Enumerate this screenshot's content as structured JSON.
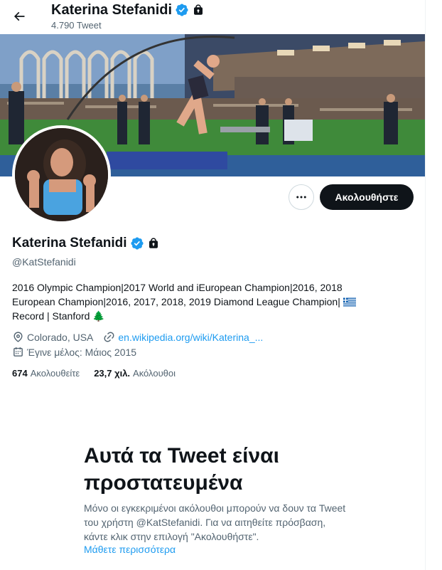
{
  "header": {
    "name": "Katerina Stefanidi",
    "tweet_count": "4.790 Tweet"
  },
  "actions": {
    "follow_label": "Ακολουθήστε",
    "more_label": "···"
  },
  "profile": {
    "name": "Katerina Stefanidi",
    "handle": "@KatStefanidi",
    "bio_line1": "2016 Olympic Champion|2017 World and iEuropean Champion|2016, 2018",
    "bio_line2": "European Champion|2016, 2017, 2018, 2019 Diamond League Champion|",
    "bio_line3a": "Record | Stanford",
    "bio_tree": "🌲",
    "location": "Colorado, USA",
    "website": "en.wikipedia.org/wiki/Katerina_...",
    "joined": "Έγινε μέλος: Μάιος 2015",
    "following_count": "674",
    "following_label": "Ακολουθείτε",
    "followers_count": "23,7 χιλ.",
    "followers_label": "Ακόλουθοι"
  },
  "protected": {
    "title": "Αυτά τα Tweet είναι προστατευμένα",
    "text": "Μόνο οι εγκεκριμένοι ακόλουθοι μπορούν να δουν τα Tweet του χρήστη @KatStefanidi. Για να αιτηθείτε πρόσβαση, κάντε κλικ στην επιλογή \"Ακολουθήστε\".",
    "link": "Μάθετε περισσότερα"
  },
  "icons": {
    "back": "arrow-left-icon",
    "verified": "verified-badge-icon",
    "lock": "lock-icon",
    "location": "location-pin-icon",
    "link": "link-icon",
    "calendar": "calendar-icon"
  },
  "colors": {
    "accent": "#1d9bf0",
    "text": "#0f1419",
    "secondary": "#536471",
    "button": "#0f1419"
  }
}
